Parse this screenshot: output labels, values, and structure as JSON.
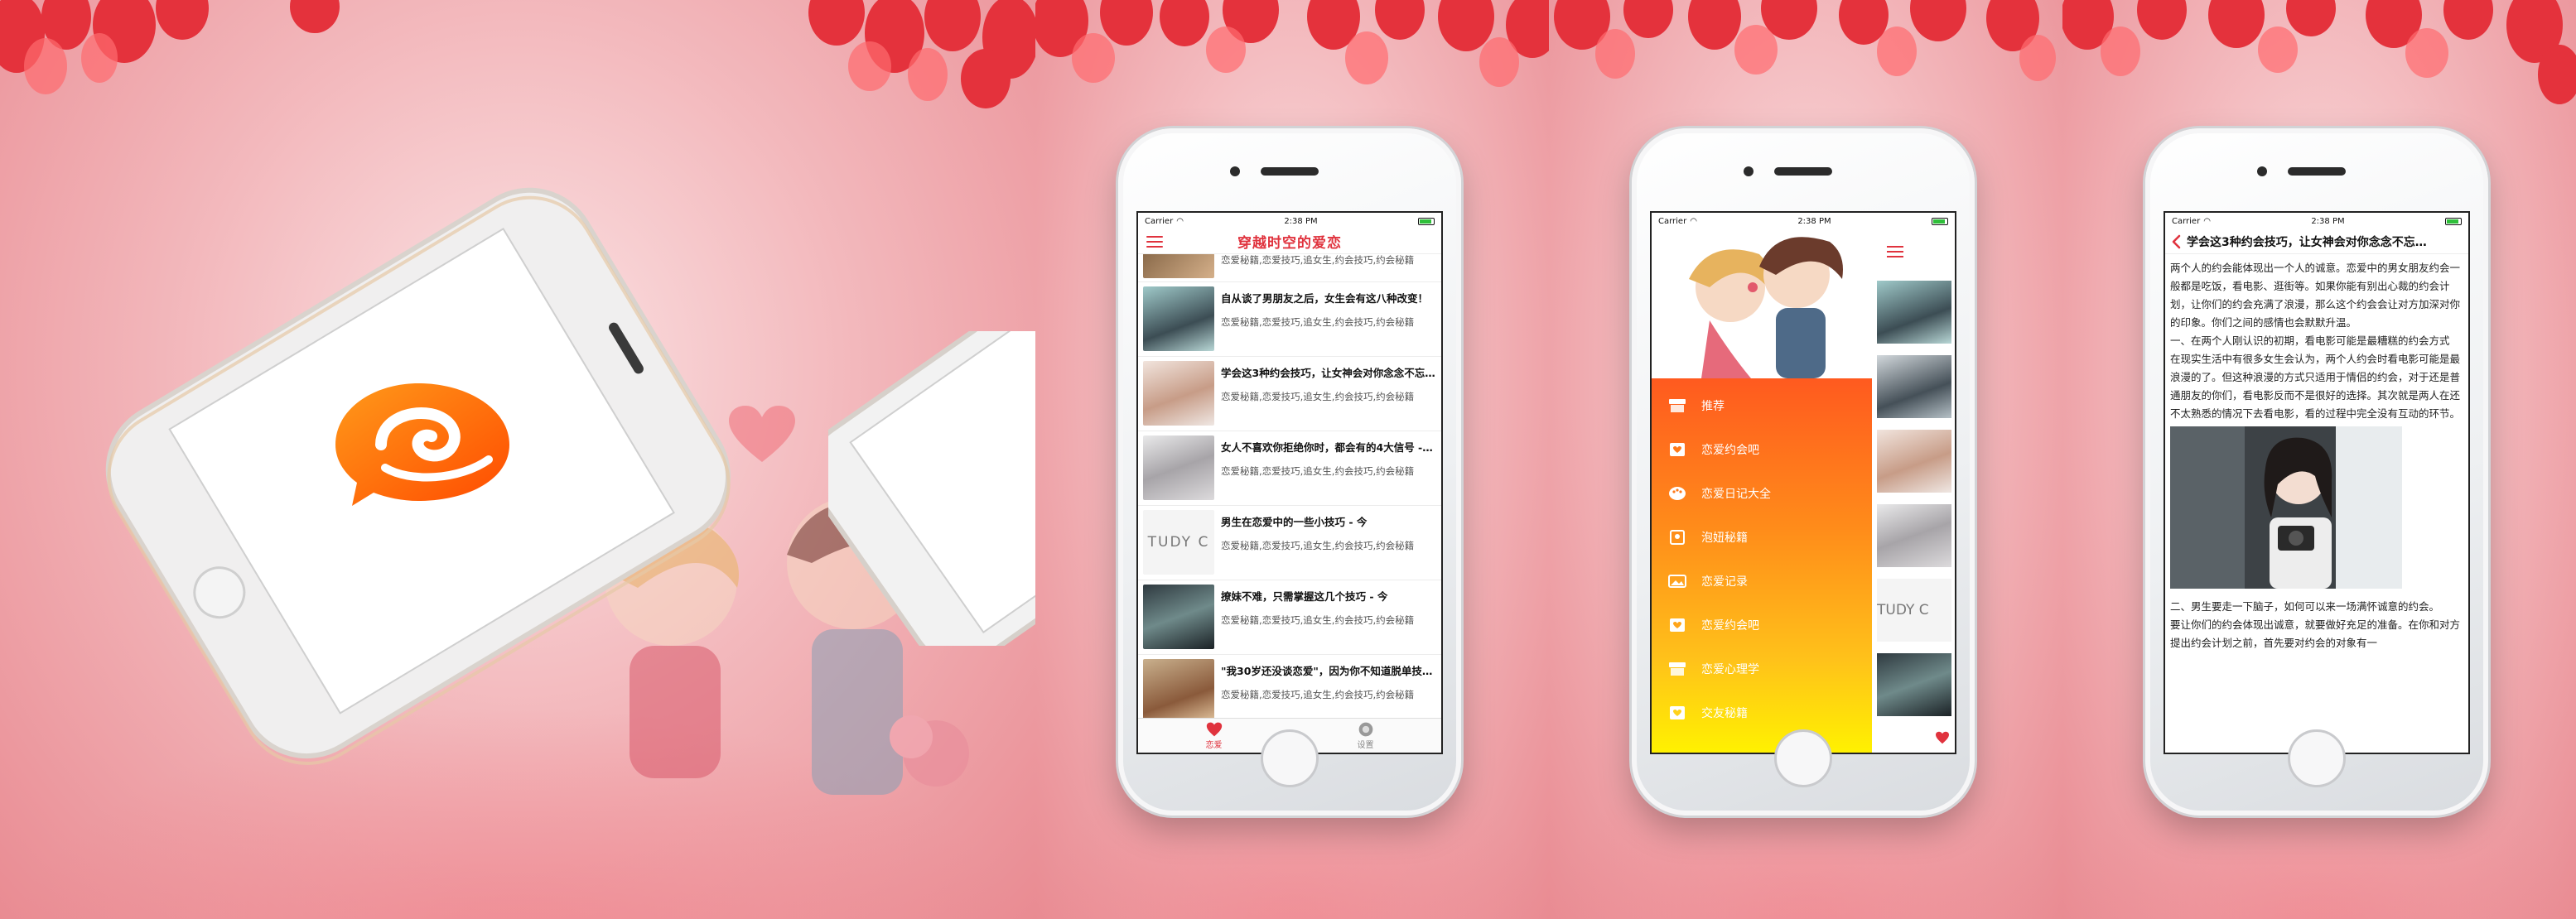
{
  "status": {
    "carrier": "Carrier",
    "time": "2:38 PM"
  },
  "list_screen": {
    "title": "穿越时空的爱恋",
    "items": [
      {
        "title": "",
        "desc": "恋爱秘籍,恋爱技巧,追女生,约会技巧,约会秘籍"
      },
      {
        "title": "自从谈了男朋友之后，女生会有这八种改变！",
        "desc": "恋爱秘籍,恋爱技巧,追女生,约会技巧,约会秘籍"
      },
      {
        "title": "学会这3种约会技巧，让女神会对你念念不忘…",
        "desc": "恋爱秘籍,恋爱技巧,追女生,约会技巧,约会秘籍"
      },
      {
        "title": "女人不喜欢你拒绝你时，都会有的4大信号 - 今",
        "desc": "恋爱秘籍,恋爱技巧,追女生,约会技巧,约会秘籍"
      },
      {
        "title": "男生在恋爱中的一些小技巧 - 今",
        "desc": "恋爱秘籍,恋爱技巧,追女生,约会技巧,约会秘籍"
      },
      {
        "title": "撩妹不难，只需掌握这几个技巧 - 今",
        "desc": "恋爱秘籍,恋爱技巧,追女生,约会技巧,约会秘籍"
      },
      {
        "title": "\"我30岁还没谈恋爱\"，因为你不知道脱单技巧…",
        "desc": "恋爱秘籍,恋爱技巧,追女生,约会技巧,约会秘籍"
      }
    ],
    "tabs": [
      {
        "label": "恋爱"
      },
      {
        "label": "设置"
      }
    ],
    "thumb_text": "TUDY C"
  },
  "drawer": {
    "items": [
      {
        "label": "推荐",
        "icon": "store-icon"
      },
      {
        "label": "恋爱约会吧",
        "icon": "heart-bag-icon"
      },
      {
        "label": "恋爱日记大全",
        "icon": "palette-icon"
      },
      {
        "label": "泡妞秘籍",
        "icon": "badge-icon"
      },
      {
        "label": "恋爱记录",
        "icon": "image-icon"
      },
      {
        "label": "恋爱约会吧",
        "icon": "heart-bag-icon"
      },
      {
        "label": "恋爱心理学",
        "icon": "store-icon"
      },
      {
        "label": "交友秘籍",
        "icon": "heart-bag-icon"
      }
    ],
    "behind_thumb_text": "TUDY C"
  },
  "article": {
    "title": "学会这3种约会技巧，让女神会对你念念不忘…",
    "para1": "两个人的约会能体现出一个人的诚意。恋爱中的男女朋友约会一般都是吃饭，看电影、逛街等。如果你能有别出心裁的约会计划，让你们的约会充满了浪漫，那么这个约会会让对方加深对你的印象。你们之间的感情也会默默升温。",
    "para2": "一、在两个人刚认识的初期，看电影可能是最糟糕的约会方式",
    "para3": "在现实生活中有很多女生会认为，两个人约会时看电影可能是最浪漫的了。但这种浪漫的方式只适用于情侣的约会，对于还是普通朋友的你们，看电影反而不是很好的选择。其次就是两人在还不太熟悉的情况下去看电影，看的过程中完全没有互动的环节。",
    "para4": "二、男生要走一下脑子，如何可以来一场满怀诚意的约会。",
    "para5": "要让你们的约会体现出诚意，就要做好充足的准备。在你和对方提出约会计划之前，首先要对约会的对象有一"
  },
  "colors": {
    "accent": "#e0333e",
    "drawer_top": "#ff5a1f",
    "drawer_bottom": "#fff200",
    "logo": "#ff6a00"
  }
}
